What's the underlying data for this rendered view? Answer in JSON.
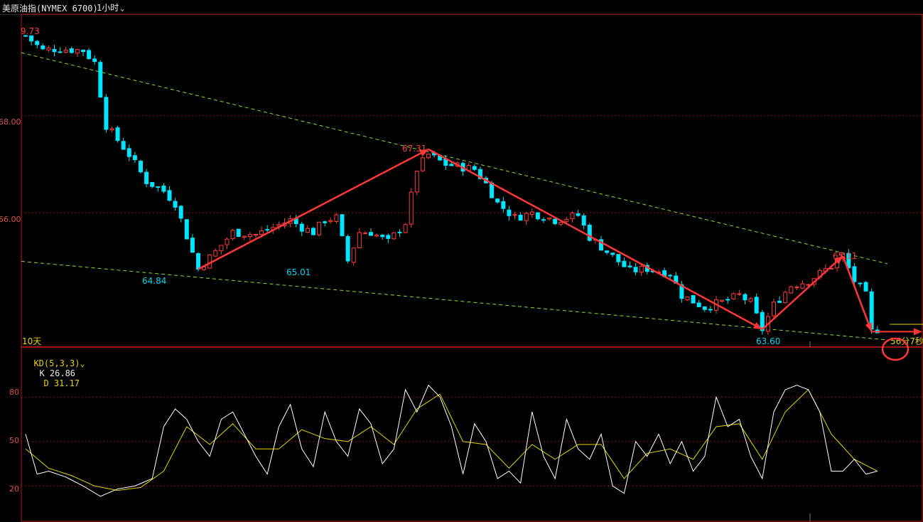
{
  "header": {
    "instrument": "美原油指(NYMEX 6700)",
    "interval": "1小时",
    "interval_chevron": "chevron-down-icon"
  },
  "colors": {
    "up": "#ff3b3b",
    "down": "#00e5ff",
    "trend": "#ff3636",
    "channel": "#8ddc2a",
    "grid": "#8a0f0f",
    "axis_price": "#e05050",
    "axis_label_cyan": "#00d6f0",
    "k_line": "#ffffff",
    "d_line": "#e6d400"
  },
  "price_axis": {
    "labels": [
      "9.73",
      "68.00",
      "66.00"
    ],
    "ticks": [
      68,
      66
    ],
    "range": [
      63.35,
      69.8
    ]
  },
  "pivot_labels": [
    {
      "text": "67.31",
      "color": "red"
    },
    {
      "text": "64.84",
      "color": "cyan"
    },
    {
      "text": "65.01",
      "color": "cyan"
    },
    {
      "text": "63.60",
      "color": "cyan"
    },
    {
      "text": "65.11",
      "color": "red"
    }
  ],
  "bottom_left_label": "10天",
  "countdown_label": "56分7秒",
  "indicator": {
    "name": "KD(5,3,3)",
    "k_text": "K 26.86",
    "d_text": "D 31.17",
    "levels": [
      "80",
      "50",
      "20"
    ]
  },
  "chart_data": {
    "type": "candlestick",
    "price_range": [
      63.35,
      69.8
    ],
    "candle_count": 149,
    "trend_points": [
      {
        "bar": 30,
        "price": 64.84
      },
      {
        "bar": 70,
        "price": 67.31
      },
      {
        "bar": 128,
        "price": 63.6
      },
      {
        "bar": 142,
        "price": 65.11
      },
      {
        "bar": 147,
        "price": 63.55
      }
    ],
    "channel_upper": [
      {
        "bar": 0,
        "price": 69.3
      },
      {
        "bar": 149,
        "price": 64.95
      }
    ],
    "channel_lower": [
      {
        "bar": 0,
        "price": 65.0
      },
      {
        "bar": 149,
        "price": 63.38
      }
    ],
    "price_path": [
      [
        0,
        69.65
      ],
      [
        3,
        69.35
      ],
      [
        5,
        69.38
      ],
      [
        10,
        69.35
      ],
      [
        12,
        69.1
      ],
      [
        14,
        67.8
      ],
      [
        18,
        67.2
      ],
      [
        21,
        66.65
      ],
      [
        24,
        66.45
      ],
      [
        26,
        66.2
      ],
      [
        30,
        64.84
      ],
      [
        33,
        65.2
      ],
      [
        36,
        65.6
      ],
      [
        40,
        65.55
      ],
      [
        44,
        65.75
      ],
      [
        46,
        65.85
      ],
      [
        48,
        65.7
      ],
      [
        50,
        65.6
      ],
      [
        52,
        65.85
      ],
      [
        54,
        65.9
      ],
      [
        56,
        65.01
      ],
      [
        58,
        65.6
      ],
      [
        60,
        65.6
      ],
      [
        63,
        65.4
      ],
      [
        66,
        65.8
      ],
      [
        68,
        66.9
      ],
      [
        70,
        67.2
      ],
      [
        73,
        67.0
      ],
      [
        78,
        66.9
      ],
      [
        80,
        66.6
      ],
      [
        82,
        66.2
      ],
      [
        85,
        65.9
      ],
      [
        88,
        66.0
      ],
      [
        92,
        65.85
      ],
      [
        96,
        65.95
      ],
      [
        98,
        65.5
      ],
      [
        102,
        65.1
      ],
      [
        105,
        64.8
      ],
      [
        108,
        64.85
      ],
      [
        112,
        64.75
      ],
      [
        114,
        64.3
      ],
      [
        118,
        64.05
      ],
      [
        122,
        64.2
      ],
      [
        124,
        64.3
      ],
      [
        126,
        64.15
      ],
      [
        128,
        63.6
      ],
      [
        130,
        64.1
      ],
      [
        133,
        64.5
      ],
      [
        136,
        64.6
      ],
      [
        140,
        64.9
      ],
      [
        142,
        65.11
      ],
      [
        144,
        64.6
      ],
      [
        146,
        64.3
      ],
      [
        147,
        63.55
      ],
      [
        148,
        63.6
      ]
    ],
    "kd_k_path": [
      [
        0,
        55
      ],
      [
        2,
        28
      ],
      [
        4,
        30
      ],
      [
        7,
        26
      ],
      [
        10,
        20
      ],
      [
        13,
        13
      ],
      [
        16,
        18
      ],
      [
        19,
        20
      ],
      [
        22,
        25
      ],
      [
        24,
        60
      ],
      [
        26,
        72
      ],
      [
        28,
        65
      ],
      [
        30,
        50
      ],
      [
        32,
        40
      ],
      [
        34,
        65
      ],
      [
        36,
        70
      ],
      [
        38,
        55
      ],
      [
        40,
        40
      ],
      [
        42,
        28
      ],
      [
        44,
        60
      ],
      [
        46,
        75
      ],
      [
        48,
        45
      ],
      [
        50,
        33
      ],
      [
        52,
        70
      ],
      [
        54,
        50
      ],
      [
        56,
        40
      ],
      [
        58,
        72
      ],
      [
        60,
        62
      ],
      [
        62,
        35
      ],
      [
        64,
        45
      ],
      [
        66,
        85
      ],
      [
        68,
        70
      ],
      [
        70,
        88
      ],
      [
        72,
        80
      ],
      [
        74,
        60
      ],
      [
        76,
        28
      ],
      [
        78,
        62
      ],
      [
        80,
        50
      ],
      [
        82,
        25
      ],
      [
        84,
        30
      ],
      [
        86,
        22
      ],
      [
        88,
        70
      ],
      [
        90,
        40
      ],
      [
        92,
        25
      ],
      [
        94,
        65
      ],
      [
        96,
        45
      ],
      [
        98,
        38
      ],
      [
        100,
        55
      ],
      [
        102,
        20
      ],
      [
        104,
        15
      ],
      [
        106,
        50
      ],
      [
        108,
        40
      ],
      [
        110,
        55
      ],
      [
        112,
        35
      ],
      [
        114,
        50
      ],
      [
        116,
        30
      ],
      [
        118,
        40
      ],
      [
        120,
        80
      ],
      [
        122,
        60
      ],
      [
        124,
        65
      ],
      [
        126,
        40
      ],
      [
        128,
        25
      ],
      [
        130,
        70
      ],
      [
        132,
        85
      ],
      [
        134,
        88
      ],
      [
        136,
        85
      ],
      [
        138,
        70
      ],
      [
        140,
        30
      ],
      [
        142,
        30
      ],
      [
        144,
        38
      ],
      [
        146,
        28
      ],
      [
        148,
        30
      ]
    ],
    "kd_d_path": [
      [
        0,
        45
      ],
      [
        4,
        32
      ],
      [
        8,
        27
      ],
      [
        12,
        20
      ],
      [
        16,
        17
      ],
      [
        20,
        19
      ],
      [
        24,
        30
      ],
      [
        28,
        60
      ],
      [
        32,
        48
      ],
      [
        36,
        62
      ],
      [
        40,
        45
      ],
      [
        44,
        45
      ],
      [
        48,
        58
      ],
      [
        52,
        52
      ],
      [
        56,
        50
      ],
      [
        60,
        60
      ],
      [
        64,
        48
      ],
      [
        68,
        72
      ],
      [
        72,
        82
      ],
      [
        76,
        50
      ],
      [
        80,
        48
      ],
      [
        84,
        32
      ],
      [
        88,
        48
      ],
      [
        92,
        38
      ],
      [
        96,
        48
      ],
      [
        100,
        48
      ],
      [
        104,
        25
      ],
      [
        108,
        42
      ],
      [
        112,
        45
      ],
      [
        116,
        38
      ],
      [
        120,
        60
      ],
      [
        124,
        62
      ],
      [
        128,
        38
      ],
      [
        132,
        70
      ],
      [
        136,
        85
      ],
      [
        140,
        55
      ],
      [
        144,
        38
      ],
      [
        148,
        30
      ]
    ]
  }
}
